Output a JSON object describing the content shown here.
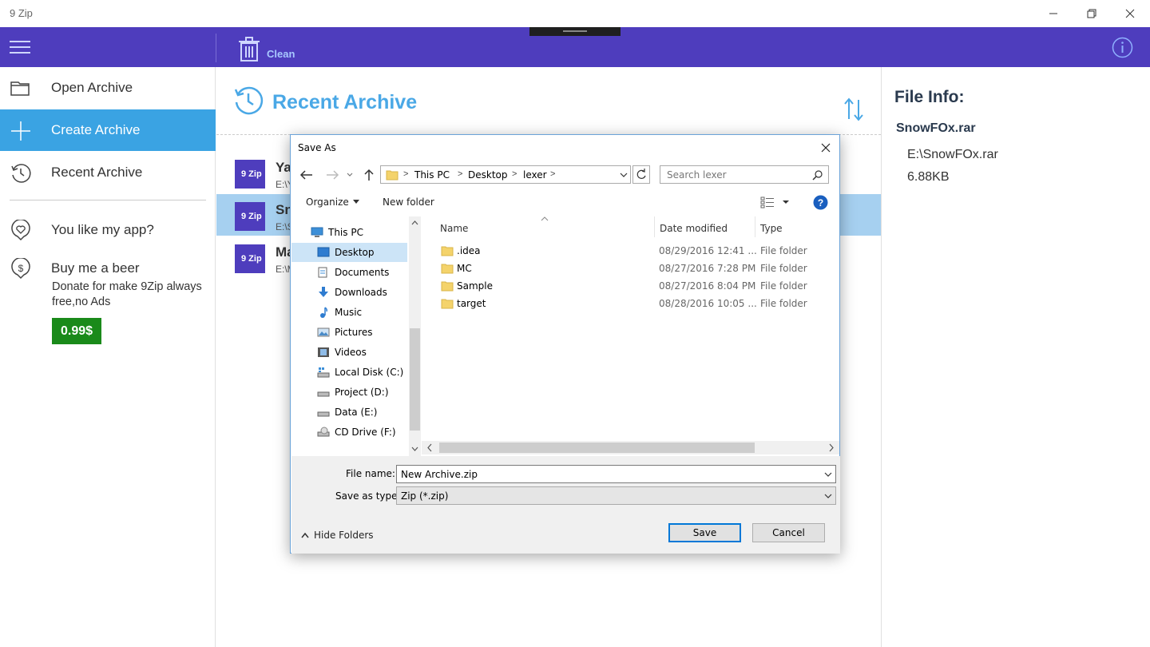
{
  "app": {
    "title": "9 Zip"
  },
  "toolbar": {
    "clean_label": "Clean"
  },
  "sidebar": {
    "items": [
      {
        "label": "Open Archive"
      },
      {
        "label": "Create Archive"
      },
      {
        "label": "Recent Archive"
      },
      {
        "label": "You like my app?"
      },
      {
        "label": "Buy me a beer"
      }
    ],
    "donate_text": "Donate for make 9Zip always free,no Ads",
    "price": "0.99$"
  },
  "main": {
    "title": "Recent Archive",
    "archives": [
      {
        "name": "Ya",
        "path": "E:\\Y"
      },
      {
        "name": "Sn",
        "path": "E:\\S"
      },
      {
        "name": "Ma",
        "path": "E:\\M"
      }
    ],
    "logo_text": "9 Zip"
  },
  "info": {
    "title": "File Info:",
    "file_name": "SnowFOx.rar",
    "file_path": "E:\\SnowFOx.rar",
    "file_size": "6.88KB"
  },
  "dialog": {
    "title": "Save As",
    "breadcrumb": [
      "This PC",
      "Desktop",
      "lexer"
    ],
    "search_placeholder": "Search lexer",
    "organize_label": "Organize",
    "new_folder_label": "New folder",
    "tree": [
      {
        "label": "This PC",
        "icon": "computer-icon"
      },
      {
        "label": "Desktop",
        "icon": "desktop-icon"
      },
      {
        "label": "Documents",
        "icon": "documents-icon"
      },
      {
        "label": "Downloads",
        "icon": "downloads-icon"
      },
      {
        "label": "Music",
        "icon": "music-icon"
      },
      {
        "label": "Pictures",
        "icon": "pictures-icon"
      },
      {
        "label": "Videos",
        "icon": "videos-icon"
      },
      {
        "label": "Local Disk (C:)",
        "icon": "drive-icon"
      },
      {
        "label": "Project (D:)",
        "icon": "drive-icon"
      },
      {
        "label": "Data (E:)",
        "icon": "drive-icon"
      },
      {
        "label": "CD Drive (F:)",
        "icon": "cd-icon"
      }
    ],
    "columns": {
      "name": "Name",
      "date": "Date modified",
      "type": "Type"
    },
    "files": [
      {
        "name": ".idea",
        "date": "08/29/2016 12:41 ...",
        "type": "File folder"
      },
      {
        "name": "MC",
        "date": "08/27/2016 7:28 PM",
        "type": "File folder"
      },
      {
        "name": "Sample",
        "date": "08/27/2016 8:04 PM",
        "type": "File folder"
      },
      {
        "name": "target",
        "date": "08/28/2016 10:05 ...",
        "type": "File folder"
      }
    ],
    "file_name_label": "File name:",
    "file_name_value": "New Archive.zip",
    "save_type_label": "Save as type:",
    "save_type_value": "Zip (*.zip)",
    "hide_folders_label": "Hide Folders",
    "save_label": "Save",
    "cancel_label": "Cancel"
  },
  "colors": {
    "toolbar": "#4e3dbd",
    "accent": "#3aa3e3",
    "title_blue": "#4aa8e6",
    "price_green": "#1a8a1a",
    "selected_row": "#a6d0f0"
  }
}
